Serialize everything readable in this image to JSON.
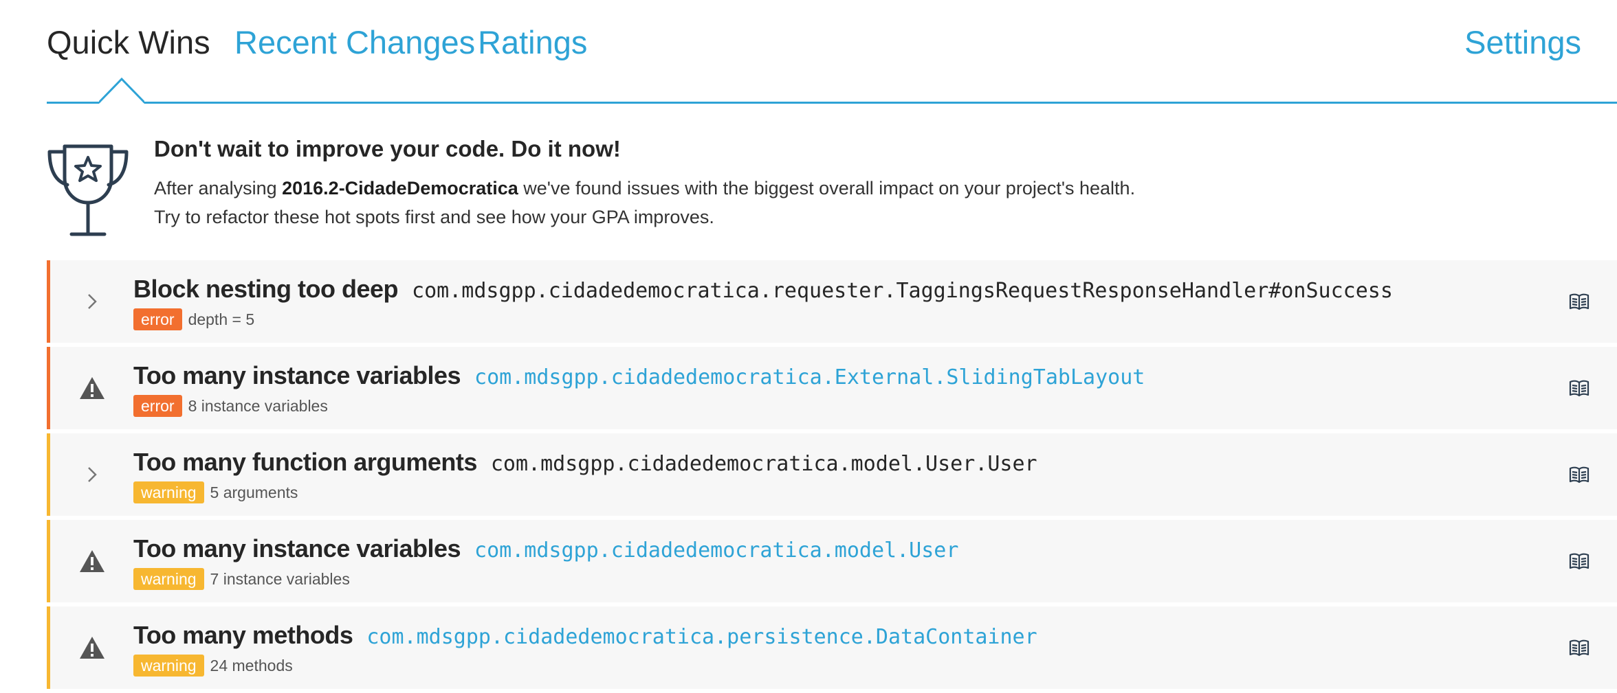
{
  "tabs": {
    "quick_wins": "Quick Wins",
    "recent_changes": "Recent Changes",
    "ratings": "Ratings",
    "settings": "Settings"
  },
  "intro": {
    "heading": "Don't wait to improve your code. Do it now!",
    "line1_prefix": "After analysing ",
    "project": "2016.2-CidadeDemocratica",
    "line1_suffix": " we've found issues with the biggest overall impact on your project's health.",
    "line2": "Try to refactor these hot spots first and see how your GPA improves."
  },
  "issues": [
    {
      "title": "Block nesting too deep",
      "path": "com.mdsgpp.cidadedemocratica.requester.TaggingsRequestResponseHandler#onSuccess",
      "badge": "error",
      "detail": "depth = 5",
      "lead_icon": "chevron-right-icon"
    },
    {
      "title": "Too many instance variables",
      "path": "com.mdsgpp.cidadedemocratica.External.SlidingTabLayout",
      "badge": "error",
      "detail": "8 instance variables",
      "lead_icon": "warning-triangle-icon"
    },
    {
      "title": "Too many function arguments",
      "path": "com.mdsgpp.cidadedemocratica.model.User.User",
      "badge": "warning",
      "detail": "5 arguments",
      "lead_icon": "chevron-right-icon"
    },
    {
      "title": "Too many instance variables",
      "path": "com.mdsgpp.cidadedemocratica.model.User",
      "badge": "warning",
      "detail": "7 instance variables",
      "lead_icon": "warning-triangle-icon"
    },
    {
      "title": "Too many methods",
      "path": "com.mdsgpp.cidadedemocratica.persistence.DataContainer",
      "badge": "warning",
      "detail": "24 methods",
      "lead_icon": "warning-triangle-icon"
    }
  ],
  "colors": {
    "accent": "#2ea3d6",
    "error": "#f26f2f",
    "warning": "#f7b731",
    "row_background": "#f7f7f7"
  }
}
